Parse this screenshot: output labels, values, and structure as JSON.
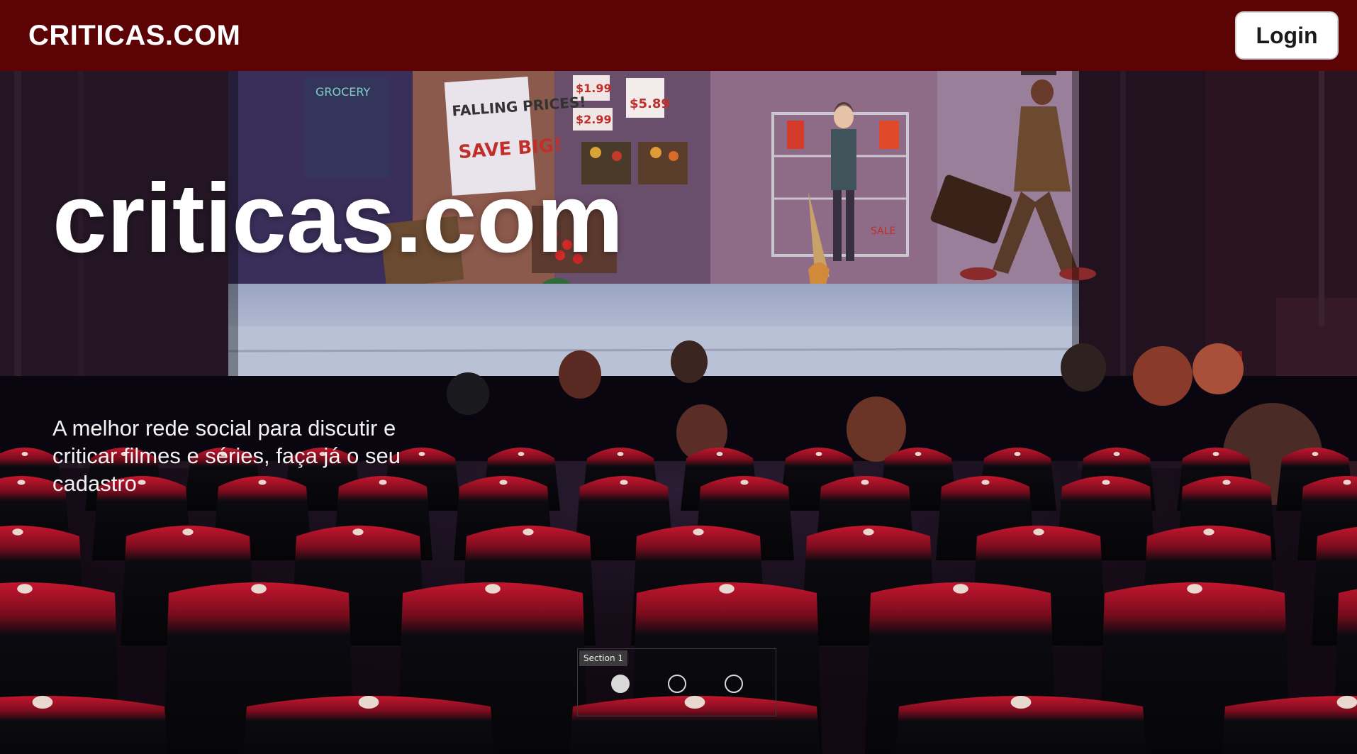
{
  "navbar": {
    "brand": "CRITICAS.COM",
    "login_label": "Login"
  },
  "hero": {
    "title": "criticas.com",
    "subtitle": "A melhor rede social para discutir e criticar filmes e séries, faça já o seu cadastro",
    "screen_signs": {
      "sign1": "FALLING PRICES!",
      "sign2": "SAVE BIG!",
      "price1": "$5.89",
      "price2": "$1.99",
      "price3": "$2.99",
      "store": "GROCERY",
      "sale": "SALE"
    }
  },
  "carousel": {
    "section_label": "Section 1",
    "dots": [
      {
        "name": "slide-1",
        "active": true
      },
      {
        "name": "slide-2",
        "active": false
      },
      {
        "name": "slide-3",
        "active": false
      }
    ]
  },
  "colors": {
    "navbar_bg": "#5c0306",
    "seat_red": "#b3102a",
    "screen_sky": "#8a6a9e"
  }
}
